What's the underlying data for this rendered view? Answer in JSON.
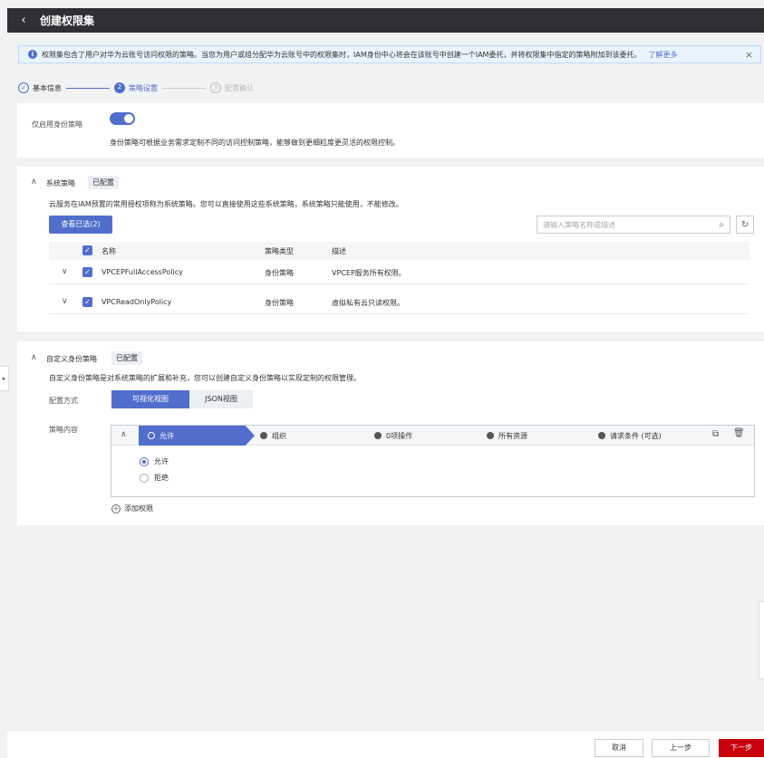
{
  "header": {
    "back_icon": "chevron-left-icon",
    "title": "创建权限集"
  },
  "notice": {
    "text": "权限集包含了用户对华为云账号访问权限的策略。当您为用户或组分配华为云账号中的权限集时，IAM身份中心将会在该账号中创建一个IAM委托，并将权限集中指定的策略附加到该委托。",
    "link": "了解更多",
    "close": "×"
  },
  "steps": [
    {
      "num": "✓",
      "label": "基本信息",
      "state": "done"
    },
    {
      "num": "2",
      "label": "策略设置",
      "state": "active"
    },
    {
      "num": "3",
      "label": "配置确认",
      "state": "pending"
    }
  ],
  "identity_only": {
    "label": "仅启用身份策略",
    "enabled": true,
    "description": "身份策略可根据业务需求定制不同的访问控制策略，能够做到更细粒度更灵活的权限控制。"
  },
  "system_policy": {
    "title": "系统策略",
    "badge": "已配置",
    "description": "云服务在IAM预置的常用授权项称为系统策略。您可以直接使用这些系统策略，系统策略只能使用，不能修改。",
    "view_selected": "查看已选(2)",
    "search_placeholder": "请输入策略名称或描述",
    "columns": [
      "名称",
      "策略类型",
      "描述"
    ],
    "rows": [
      {
        "name": "VPCEPFullAccessPolicy",
        "type": "身份策略",
        "desc": "VPCEP服务所有权限。"
      },
      {
        "name": "VPCReadOnlyPolicy",
        "type": "身份策略",
        "desc": "虚拟私有云只读权限。"
      }
    ]
  },
  "custom_policy": {
    "title": "自定义身份策略",
    "badge": "已配置",
    "description": "自定义身份策略是对系统策略的扩展和补充，您可以创建自定义身份策略以实现定制的权限管理。",
    "config_label": "配置方式",
    "tabs": [
      "可视化视图",
      "JSON视图"
    ],
    "content_label": "策略内容",
    "segments": [
      "允许",
      "组织",
      "0项操作",
      "所有资源",
      "请求条件 (可选)"
    ],
    "effect_options": [
      "允许",
      "拒绝"
    ],
    "selected_effect": "允许",
    "add_permission": "添加权限"
  },
  "footer": {
    "cancel": "取消",
    "prev": "上一步",
    "next": "下一步"
  }
}
